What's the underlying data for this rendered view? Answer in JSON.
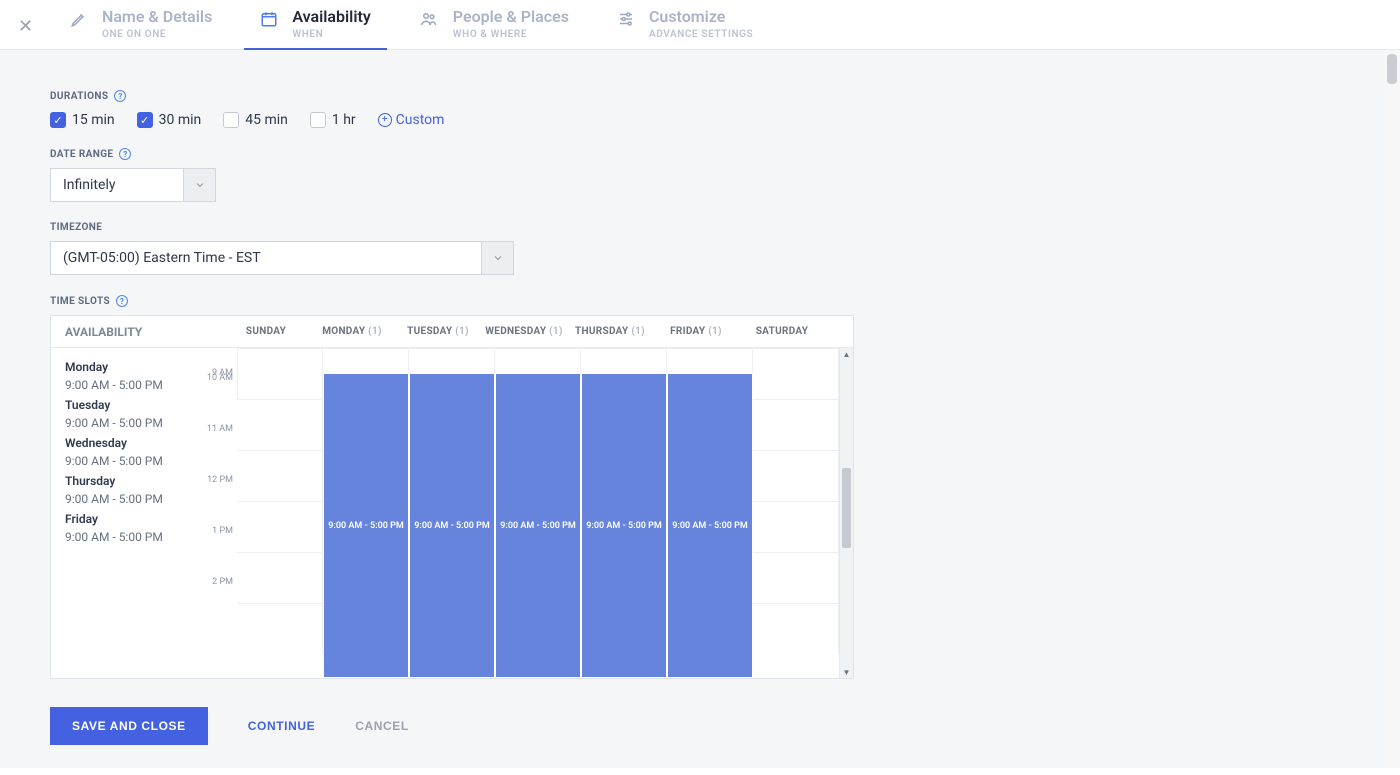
{
  "tabs": [
    {
      "title": "Name & Details",
      "sub": "ONE ON ONE"
    },
    {
      "title": "Availability",
      "sub": "WHEN"
    },
    {
      "title": "People & Places",
      "sub": "WHO & WHERE"
    },
    {
      "title": "Customize",
      "sub": "ADVANCE SETTINGS"
    }
  ],
  "sections": {
    "durations_label": "DURATIONS",
    "date_range_label": "DATE RANGE",
    "timezone_label": "TIMEZONE",
    "time_slots_label": "TIME SLOTS"
  },
  "durations": {
    "items": [
      {
        "label": "15 min",
        "checked": true
      },
      {
        "label": "30 min",
        "checked": true
      },
      {
        "label": "45 min",
        "checked": false
      },
      {
        "label": "1 hr",
        "checked": false
      }
    ],
    "custom_label": "Custom"
  },
  "date_range": {
    "value": "Infinitely"
  },
  "timezone": {
    "value": "(GMT-05:00) Eastern Time - EST"
  },
  "slots": {
    "availability_title": "AVAILABILITY",
    "day_headers": [
      {
        "name": "SUNDAY",
        "count": ""
      },
      {
        "name": "MONDAY",
        "count": "(1)"
      },
      {
        "name": "TUESDAY",
        "count": "(1)"
      },
      {
        "name": "WEDNESDAY",
        "count": "(1)"
      },
      {
        "name": "THURSDAY",
        "count": "(1)"
      },
      {
        "name": "FRIDAY",
        "count": "(1)"
      },
      {
        "name": "SATURDAY",
        "count": ""
      }
    ],
    "sidebar_days": [
      {
        "day": "Monday",
        "range": "9:00 AM - 5:00 PM"
      },
      {
        "day": "Tuesday",
        "range": "9:00 AM - 5:00 PM"
      },
      {
        "day": "Wednesday",
        "range": "9:00 AM - 5:00 PM"
      },
      {
        "day": "Thursday",
        "range": "9:00 AM - 5:00 PM"
      },
      {
        "day": "Friday",
        "range": "9:00 AM - 5:00 PM"
      }
    ],
    "hour_labels": [
      "9 AM",
      "10 AM",
      "11 AM",
      "12 PM",
      "1 PM",
      "2 PM"
    ],
    "block_label": "9:00 AM - 5:00 PM"
  },
  "footer": {
    "save": "SAVE AND CLOSE",
    "continue": "CONTINUE",
    "cancel": "CANCEL"
  }
}
